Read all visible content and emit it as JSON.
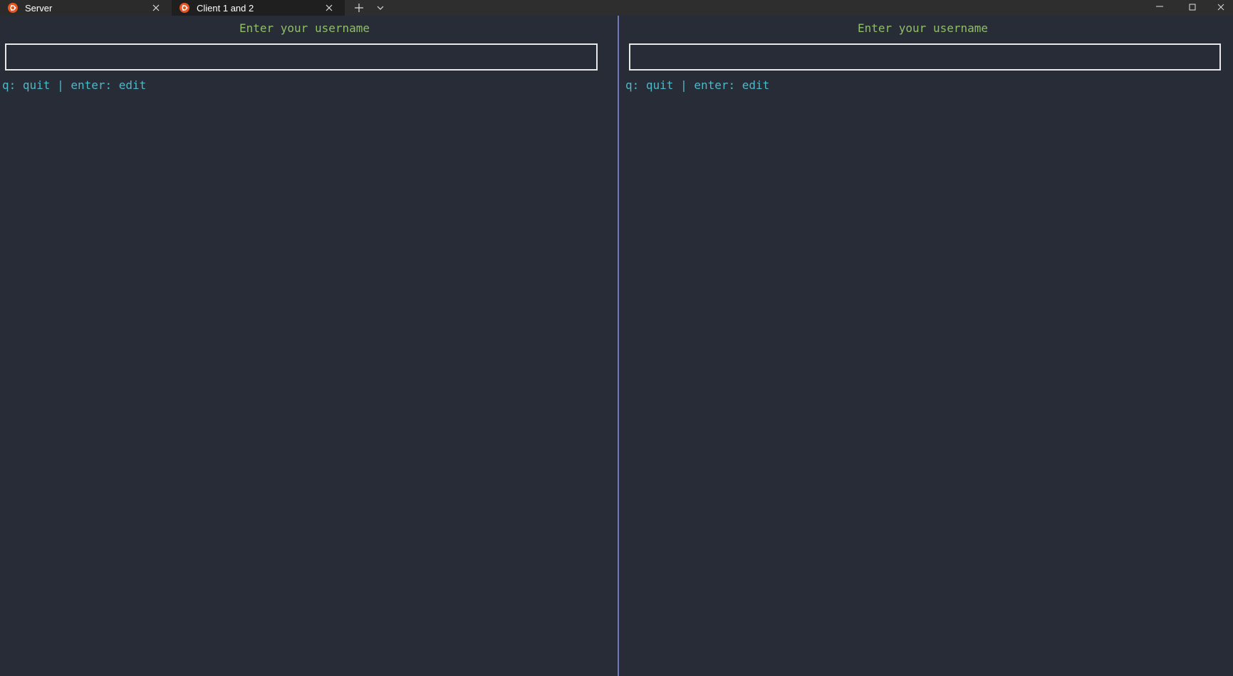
{
  "tabs": [
    {
      "label": "Server",
      "active": false,
      "icon": "ubuntu-icon"
    },
    {
      "label": "Client 1 and 2",
      "active": true,
      "icon": "ubuntu-icon"
    }
  ],
  "colors": {
    "background": "#282c37",
    "prompt_text": "#8fbf67",
    "help_text": "#4fb8c8",
    "divider": "#7279b8",
    "ubuntu_logo": "#e95420"
  },
  "panes": [
    {
      "prompt": "Enter your username",
      "input_value": "",
      "help": "q: quit | enter: edit"
    },
    {
      "prompt": "Enter your username",
      "input_value": "",
      "help": "q: quit | enter: edit"
    }
  ]
}
